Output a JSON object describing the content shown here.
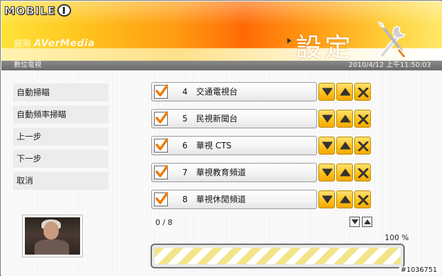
{
  "branding": {
    "site_logo_text": "MOBILE",
    "product_logo_cn": "圓剛",
    "product_logo": "AVerMedia"
  },
  "header": {
    "title": "設定"
  },
  "status_bar": {
    "app_name": "數位電視",
    "datetime": "2010/4/12 上午11:50:03"
  },
  "menu": {
    "items": [
      {
        "label": "自動掃瞄"
      },
      {
        "label": "自動頻率掃瞄"
      },
      {
        "label": "上一步"
      },
      {
        "label": "下一步"
      },
      {
        "label": "取消"
      }
    ]
  },
  "channels": [
    {
      "number": "4",
      "name": "交通電視台",
      "checked": true
    },
    {
      "number": "5",
      "name": "民視新聞台",
      "checked": true
    },
    {
      "number": "6",
      "name": "華視 CTS",
      "checked": true
    },
    {
      "number": "7",
      "name": "華視教育頻道",
      "checked": true
    },
    {
      "number": "8",
      "name": "華視休閒頻道",
      "checked": true
    }
  ],
  "scan": {
    "count": "0 / 8",
    "percent_label": "100 %",
    "progress": 1.0
  },
  "watermark": "#1036751",
  "colors": {
    "accent_orange": "#ff6a06",
    "button_yellow": "#ffc21a",
    "check_orange": "#f07800"
  },
  "icons": {
    "move_down": "triangle-down-icon",
    "move_up": "triangle-up-icon",
    "delete": "x-icon",
    "tools": "wrench-screwdriver-icon"
  }
}
